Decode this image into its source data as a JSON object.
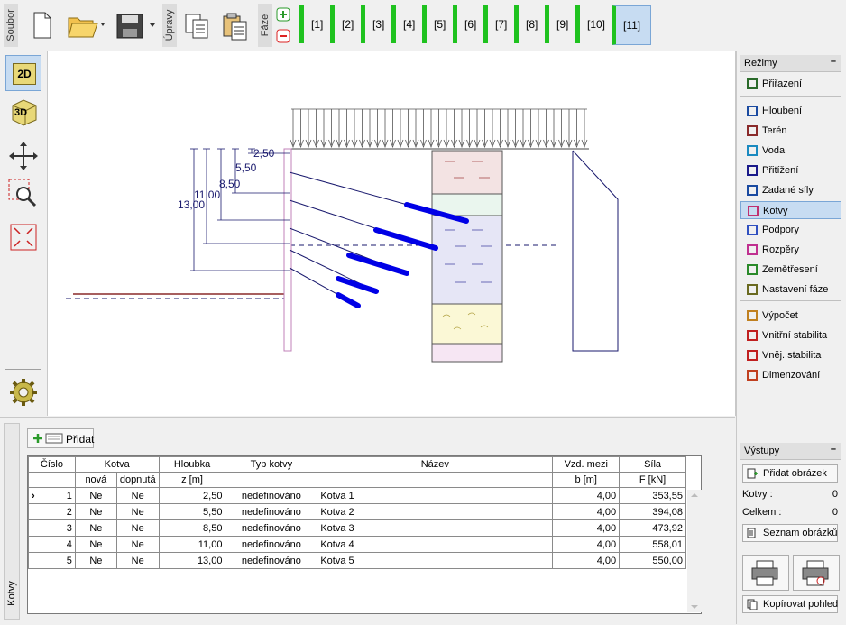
{
  "toolbar": {
    "file_label": "Soubor",
    "edit_label": "Úpravy",
    "stage_label": "Fáze",
    "stages": [
      "[1]",
      "[2]",
      "[3]",
      "[4]",
      "[5]",
      "[6]",
      "[7]",
      "[8]",
      "[9]",
      "[10]",
      "[11]"
    ],
    "active_stage": "[11]",
    "icons": [
      "new-file-icon",
      "open-folder-icon",
      "save-icon",
      "copy-stage-icon",
      "paste-stage-icon",
      "add-stage-icon",
      "remove-stage-icon"
    ]
  },
  "left_tools": {
    "view_2d": "2D",
    "view_3d": "3D",
    "icons": [
      "move-icon",
      "zoom-icon",
      "fit-view-icon",
      "settings-gear-icon"
    ]
  },
  "drawing": {
    "depth_labels": [
      "2,50",
      "5,50",
      "8,50",
      "11,00",
      "13,00"
    ],
    "colors": {
      "anchor_line": "#1a1a6e",
      "grout": "#0000e6",
      "wall": "#cfa0c8",
      "dimension": "#1a1a6e"
    }
  },
  "right_panel": {
    "modes_header": "Režimy",
    "modes": [
      {
        "label": "Přiřazení",
        "icon": "assign-icon"
      },
      {
        "label": "Hloubení",
        "icon": "excavation-icon"
      },
      {
        "label": "Terén",
        "icon": "terrain-icon"
      },
      {
        "label": "Voda",
        "icon": "water-icon"
      },
      {
        "label": "Přitížení",
        "icon": "surcharge-icon"
      },
      {
        "label": "Zadané síly",
        "icon": "applied-forces-icon"
      },
      {
        "label": "Kotvy",
        "icon": "anchors-icon"
      },
      {
        "label": "Podpory",
        "icon": "supports-icon"
      },
      {
        "label": "Rozpěry",
        "icon": "struts-icon"
      },
      {
        "label": "Zemětřesení",
        "icon": "earthquake-icon"
      },
      {
        "label": "Nastavení fáze",
        "icon": "stage-settings-icon"
      },
      {
        "label": "Výpočet",
        "icon": "analysis-icon"
      },
      {
        "label": "Vnitřní stabilita",
        "icon": "internal-stability-icon"
      },
      {
        "label": "Vněj. stabilita",
        "icon": "external-stability-icon"
      },
      {
        "label": "Dimenzování",
        "icon": "design-icon"
      }
    ],
    "active_mode": "Kotvy",
    "outputs_header": "Výstupy",
    "add_picture": "Přidat obrázek",
    "anchors_count_label": "Kotvy :",
    "anchors_count": "0",
    "total_label": "Celkem :",
    "total": "0",
    "picture_list": "Seznam obrázků",
    "copy_view": "Kopírovat pohled"
  },
  "bottom_panel": {
    "side_tab": "Kotvy",
    "add_button": "Přidat",
    "headers": {
      "cislo": "Číslo",
      "kotva": "Kotva",
      "nova": "nová",
      "dopnuta": "dopnutá",
      "hloubka": "Hloubka",
      "hloubka_unit": "z [m]",
      "typ": "Typ kotvy",
      "nazev": "Název",
      "vzd": "Vzd. mezi",
      "vzd_unit": "b [m]",
      "sila": "Síla",
      "sila_unit": "F [kN]"
    },
    "rows": [
      {
        "num": "1",
        "nova": "Ne",
        "dopnuta": "Ne",
        "z": "2,50",
        "typ": "nedefinováno",
        "nazev": "Kotva 1",
        "b": "4,00",
        "F": "353,55"
      },
      {
        "num": "2",
        "nova": "Ne",
        "dopnuta": "Ne",
        "z": "5,50",
        "typ": "nedefinováno",
        "nazev": "Kotva 2",
        "b": "4,00",
        "F": "394,08"
      },
      {
        "num": "3",
        "nova": "Ne",
        "dopnuta": "Ne",
        "z": "8,50",
        "typ": "nedefinováno",
        "nazev": "Kotva 3",
        "b": "4,00",
        "F": "473,92"
      },
      {
        "num": "4",
        "nova": "Ne",
        "dopnuta": "Ne",
        "z": "11,00",
        "typ": "nedefinováno",
        "nazev": "Kotva 4",
        "b": "4,00",
        "F": "558,01"
      },
      {
        "num": "5",
        "nova": "Ne",
        "dopnuta": "Ne",
        "z": "13,00",
        "typ": "nedefinováno",
        "nazev": "Kotva 5",
        "b": "4,00",
        "F": "550,00"
      }
    ]
  }
}
